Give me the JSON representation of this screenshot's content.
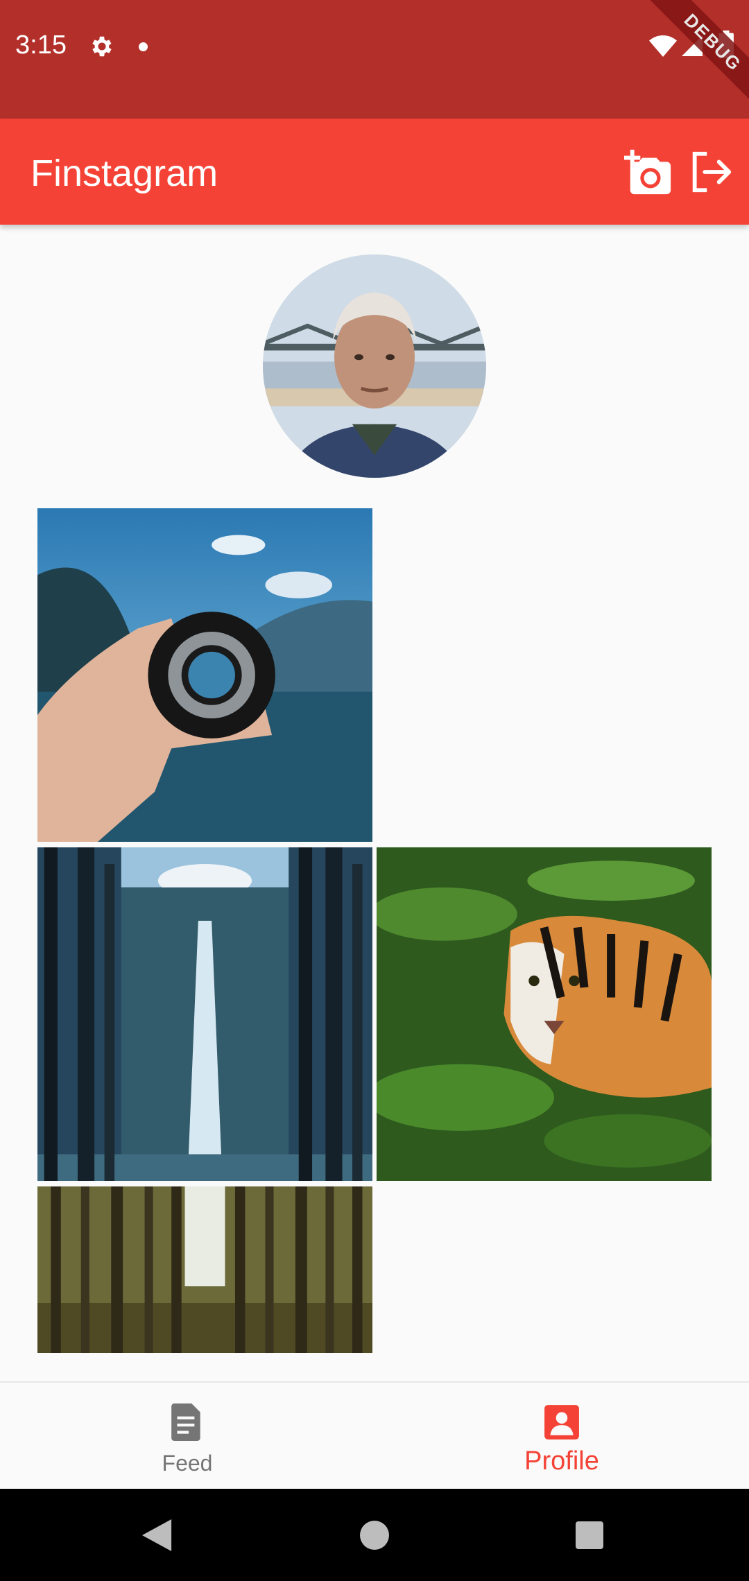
{
  "status_bar": {
    "time": "3:15",
    "debug_label": "DEBUG",
    "icons": [
      "gear-icon",
      "notification-dot-icon",
      "wifi-icon",
      "signal-icon",
      "battery-icon"
    ]
  },
  "app_bar": {
    "title": "Finstagram",
    "actions": [
      "add-photo-icon",
      "logout-icon"
    ],
    "background_color": "#f44336",
    "status_color": "#b3302a"
  },
  "profile": {
    "avatar": "old-man-portrait"
  },
  "posts": [
    {
      "image": "hand-holding-camera-lens-lake"
    },
    {
      "image": "waterfall-forest"
    },
    {
      "image": "tiger-in-water"
    },
    {
      "image": "tall-tree-forest"
    }
  ],
  "bottom_nav": {
    "items": [
      {
        "label": "Feed",
        "icon": "document-icon",
        "active": false
      },
      {
        "label": "Profile",
        "icon": "account-box-icon",
        "active": true
      }
    ],
    "active_color": "#f44336",
    "inactive_color": "#757575"
  },
  "system_nav": {
    "icons": [
      "back-icon",
      "home-icon",
      "recents-icon"
    ]
  }
}
